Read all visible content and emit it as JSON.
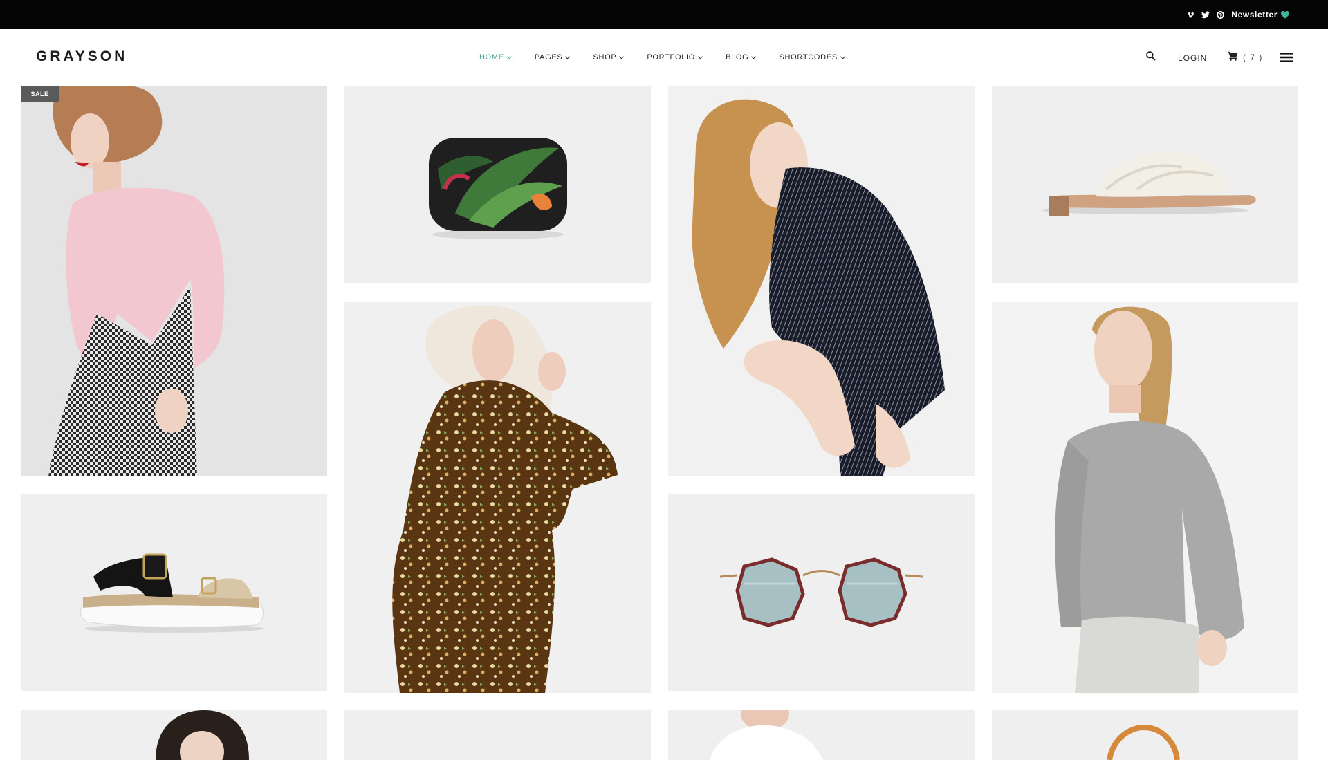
{
  "topbar": {
    "social": [
      {
        "name": "vimeo-icon",
        "glyph": "v"
      },
      {
        "name": "twitter-icon",
        "glyph": "t"
      },
      {
        "name": "pinterest-icon",
        "glyph": "p"
      }
    ],
    "newsletter_label": "Newsletter",
    "heart_color": "#3fb39a"
  },
  "header": {
    "logo": "GRAYSON",
    "nav": [
      {
        "label": "HOME",
        "active": true
      },
      {
        "label": "PAGES",
        "active": false
      },
      {
        "label": "SHOP",
        "active": false
      },
      {
        "label": "PORTFOLIO",
        "active": false
      },
      {
        "label": "BLOG",
        "active": false
      },
      {
        "label": "SHORTCODES",
        "active": false
      }
    ],
    "login_label": "LOGIN",
    "cart_count": "( 7 )",
    "accent_color": "#3f9e8d"
  },
  "grid": {
    "sale_badge": "SALE",
    "tiles": [
      {
        "name": "product-pink-houndstooth-dress",
        "icon": "model-photo"
      },
      {
        "name": "product-tropical-leaf-bag",
        "icon": "bag-photo"
      },
      {
        "name": "product-pinstripe-coat",
        "icon": "model-photo"
      },
      {
        "name": "product-fur-slide-sandal",
        "icon": "shoe-photo"
      },
      {
        "name": "product-floral-dress",
        "icon": "model-photo"
      },
      {
        "name": "product-grey-sweater",
        "icon": "model-photo"
      },
      {
        "name": "product-black-sandal",
        "icon": "shoe-photo"
      },
      {
        "name": "product-octagon-sunglasses",
        "icon": "sunglasses-photo"
      },
      {
        "name": "product-bottom-1",
        "icon": "model-photo"
      },
      {
        "name": "product-bottom-2",
        "icon": "blank-photo"
      },
      {
        "name": "product-bottom-3",
        "icon": "model-photo"
      },
      {
        "name": "product-bottom-4",
        "icon": "bag-photo"
      }
    ]
  }
}
